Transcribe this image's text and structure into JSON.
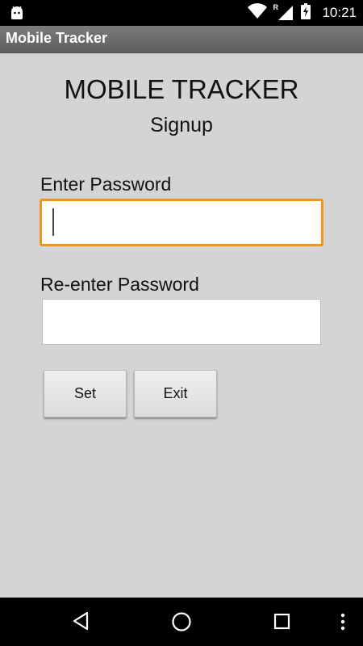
{
  "status_bar": {
    "time": "10:21",
    "icons": [
      "android-icon",
      "wifi-icon",
      "roaming-signal-icon",
      "battery-charging-icon"
    ],
    "roaming_indicator": "R"
  },
  "action_bar": {
    "title": "Mobile Tracker"
  },
  "main": {
    "heading": "MOBILE TRACKER",
    "subheading": "Signup",
    "password_field": {
      "label": "Enter Password",
      "value": "",
      "placeholder": ""
    },
    "confirm_password_field": {
      "label": "Re-enter Password",
      "value": "",
      "placeholder": ""
    },
    "buttons": {
      "set_label": "Set",
      "exit_label": "Exit"
    }
  },
  "nav_bar": {
    "icons": [
      "back-icon",
      "home-icon",
      "recents-icon",
      "more-icon"
    ]
  },
  "colors": {
    "background": "#d4d4d4",
    "focus_accent": "#f2931e",
    "action_bar": "#6b6b6b"
  }
}
